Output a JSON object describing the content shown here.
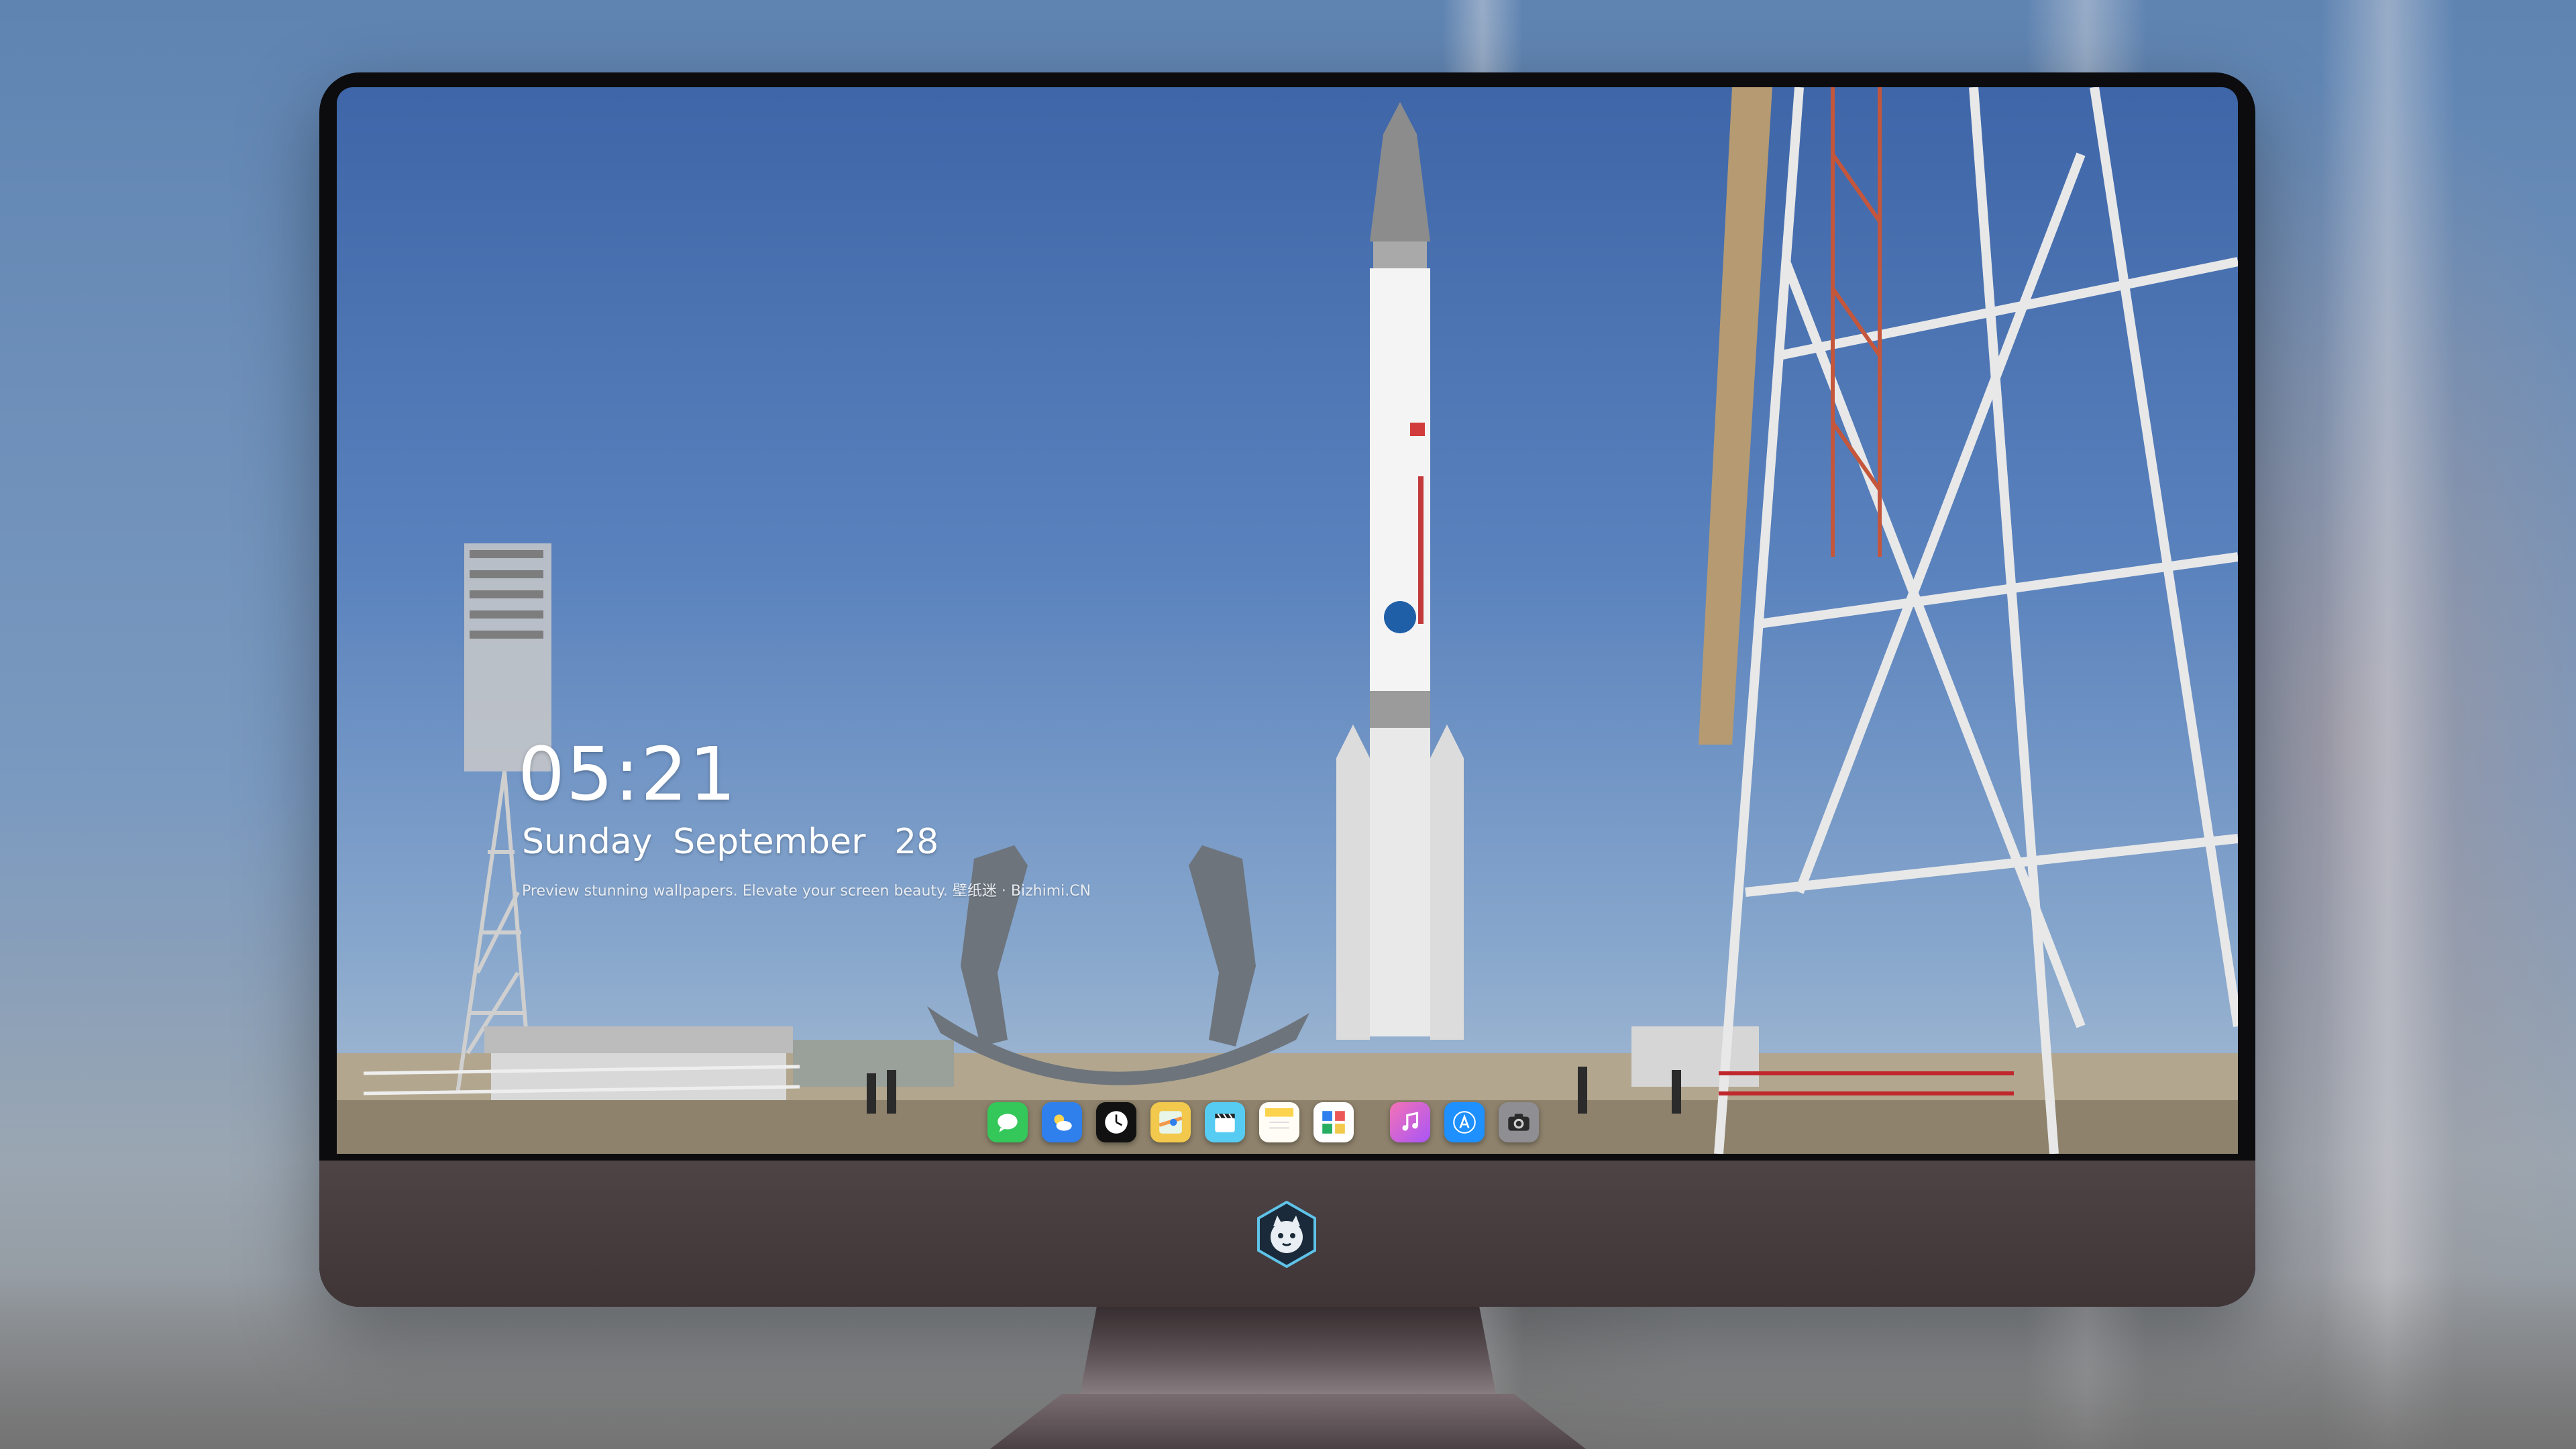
{
  "lockscreen": {
    "time": "05:21",
    "weekday": "Sunday",
    "month": "September",
    "day": "28",
    "caption": "Preview stunning wallpapers. Elevate your screen beauty. 壁纸迷 · Bizhimi.CN"
  },
  "dock": {
    "apps": [
      {
        "name": "Messages",
        "icon": "messages-icon",
        "color": "#34c759"
      },
      {
        "name": "Weather",
        "icon": "weather-icon",
        "color": "#2f80ed"
      },
      {
        "name": "Clock",
        "icon": "clock-icon",
        "color": "#111111"
      },
      {
        "name": "Maps",
        "icon": "maps-icon",
        "color": "#f2c94c"
      },
      {
        "name": "Clips",
        "icon": "clips-icon",
        "color": "#56ccf2"
      },
      {
        "name": "Notes",
        "icon": "notes-icon",
        "color": "#fde68a"
      },
      {
        "name": "Photos",
        "icon": "photos-icon",
        "color": "#ffffff"
      },
      {
        "name": "Music",
        "icon": "music-icon",
        "color": "#d946ef"
      },
      {
        "name": "App Store",
        "icon": "app-store-icon",
        "color": "#1e90ff"
      },
      {
        "name": "Camera",
        "icon": "camera-icon",
        "color": "#8e8e93"
      }
    ]
  },
  "monitor": {
    "badge_icon": "cat-mascot-logo-icon",
    "bezel_color": "#0c0c0e",
    "chin_color": "#4a3f42"
  }
}
